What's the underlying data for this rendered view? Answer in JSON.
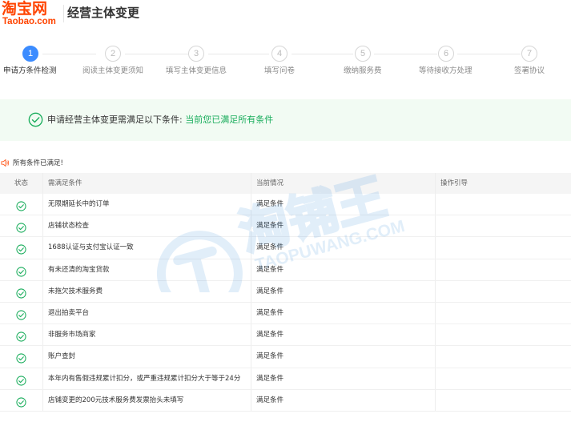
{
  "header": {
    "logo_main": "淘宝网",
    "logo_sub": "Taobao.com",
    "title": "经营主体变更"
  },
  "steps": [
    {
      "num": "1",
      "label": "申请方条件检测",
      "active": true
    },
    {
      "num": "2",
      "label": "阅读主体变更须知",
      "active": false
    },
    {
      "num": "3",
      "label": "填写主体变更信息",
      "active": false
    },
    {
      "num": "4",
      "label": "填写问卷",
      "active": false
    },
    {
      "num": "5",
      "label": "缴纳服务费",
      "active": false
    },
    {
      "num": "6",
      "label": "等待接收方处理",
      "active": false
    },
    {
      "num": "7",
      "label": "签署协议",
      "active": false
    }
  ],
  "notice": {
    "icon": "check-circle-icon",
    "text": "申请经营主体变更需满足以下条件: ",
    "highlight": "当前您已满足所有条件"
  },
  "all_satisfied": {
    "icon": "speaker-icon",
    "text": "所有条件已满足!"
  },
  "table": {
    "headers": {
      "status": "状态",
      "condition": "需满足条件",
      "current": "当前情况",
      "guide": "操作引导"
    },
    "rows": [
      {
        "condition": "无限期延长中的订单",
        "current": "满足条件"
      },
      {
        "condition": "店铺状态检查",
        "current": "满足条件"
      },
      {
        "condition": "1688认证与支付宝认证一致",
        "current": "满足条件"
      },
      {
        "condition": "有未还清的淘宝贷款",
        "current": "满足条件"
      },
      {
        "condition": "未拖欠技术服务费",
        "current": "满足条件"
      },
      {
        "condition": "退出拍卖平台",
        "current": "满足条件"
      },
      {
        "condition": "非服务市场商家",
        "current": "满足条件"
      },
      {
        "condition": "账户查封",
        "current": "满足条件"
      },
      {
        "condition": "本年内有售假违规累计扣分，或严重违规累计扣分大于等于24分",
        "current": "满足条件"
      },
      {
        "condition": "店铺变更的200元技术服务费发票抬头未填写",
        "current": "满足条件"
      }
    ]
  },
  "watermark": {
    "main": "淘铺王",
    "sub": "TAOPUWANG.COM"
  },
  "colors": {
    "brand": "#ff4400",
    "step_active": "#3c8cff",
    "success": "#1aad5c",
    "notice_bg": "#f2fbf3"
  }
}
